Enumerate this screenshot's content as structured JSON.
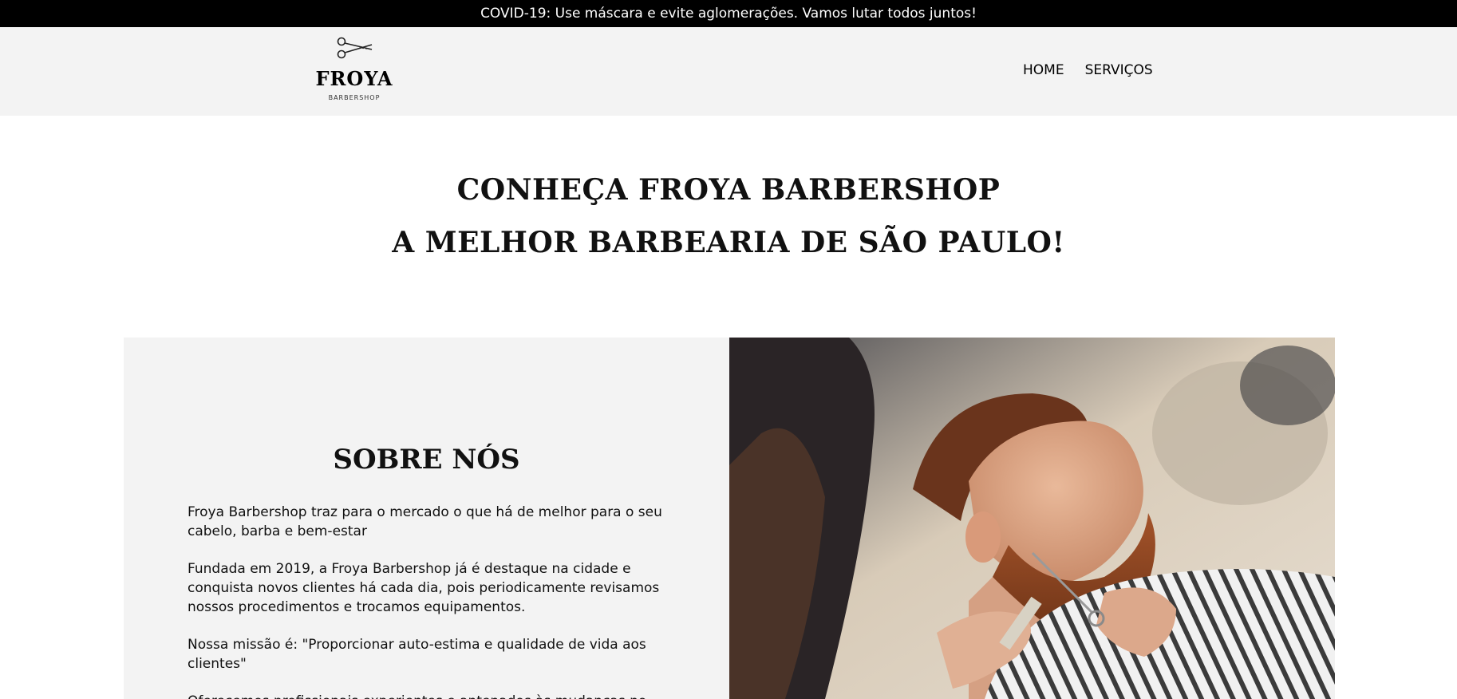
{
  "topbar": {
    "message": "COVID-19: Use máscara e evite aglomerações. Vamos lutar todos juntos!"
  },
  "header": {
    "logo": {
      "icon": "scissors-icon",
      "title": "FROYA",
      "subtitle": "BARBERSHOP"
    },
    "nav": [
      {
        "label": "HOME"
      },
      {
        "label": "SERVIÇOS"
      }
    ]
  },
  "hero": {
    "line1": "CONHEÇA FROYA BARBERSHOP",
    "line2": "A MELHOR BARBEARIA DE SÃO PAULO!"
  },
  "about": {
    "title": "SOBRE NÓS",
    "paragraphs": [
      "Froya Barbershop traz para o mercado o que há de melhor para o seu cabelo, barba e bem-estar",
      "Fundada em 2019, a Froya Barbershop já é destaque na cidade e conquista novos clientes há cada dia, pois periodicamente revisamos nossos procedimentos e trocamos equipamentos.",
      "Nossa missão é: \"Proporcionar auto-estima e qualidade de vida aos clientes\"",
      "Oferecemos profissionais experientes e antenados às mudanças no"
    ],
    "image": "barber-trimming-beard-photo"
  },
  "colors": {
    "topbar_bg": "#000000",
    "header_bg": "#f3f3f3",
    "panel_bg": "#f3f3f3"
  }
}
